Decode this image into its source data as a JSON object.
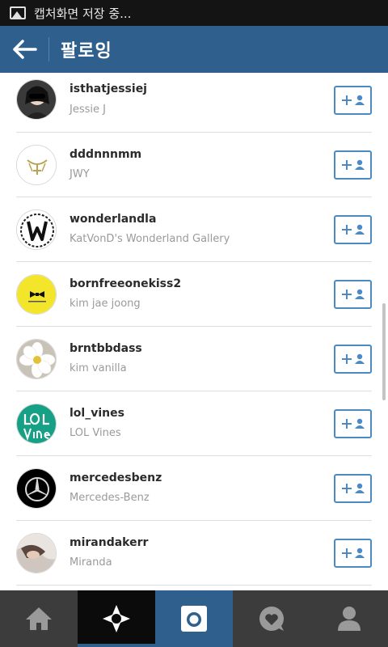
{
  "status": {
    "text": "캡처화면 저장 중..."
  },
  "header": {
    "title": "팔로잉"
  },
  "accent": "#2f5f8d",
  "follow_icon": "add-person-icon",
  "users": [
    {
      "username": "isthatjessiej",
      "fullname": "Jessie J"
    },
    {
      "username": "dddnnnmm",
      "fullname": "JWY"
    },
    {
      "username": "wonderlandla",
      "fullname": "KatVonD's Wonderland Gallery"
    },
    {
      "username": "bornfreeonekiss2",
      "fullname": "kim jae joong"
    },
    {
      "username": "brntbbdass",
      "fullname": "kim vanilla"
    },
    {
      "username": "lol_vines",
      "fullname": "LOL Vines"
    },
    {
      "username": "mercedesbenz",
      "fullname": "Mercedes-Benz"
    },
    {
      "username": "mirandakerr",
      "fullname": "Miranda"
    }
  ],
  "tabs": [
    "home",
    "explore",
    "camera",
    "news",
    "profile"
  ]
}
